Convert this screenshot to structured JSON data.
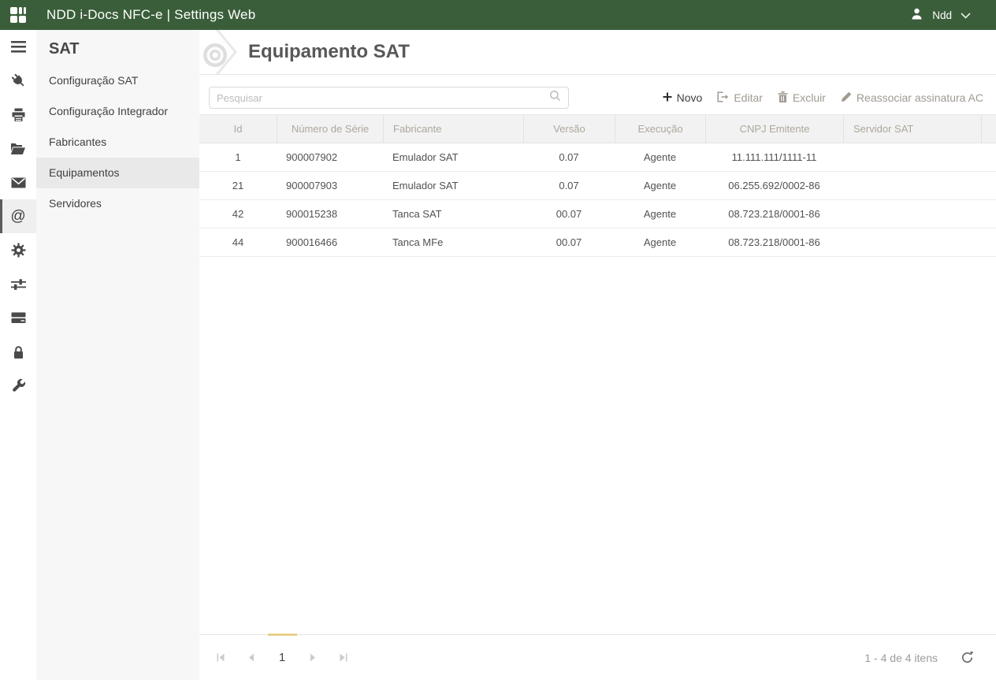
{
  "topbar": {
    "title": "NDD i-Docs NFC-e | Settings Web",
    "user": "Ndd"
  },
  "colors": {
    "topbar_bg": "#3b5e3a",
    "pager_accent": "#e7d18c",
    "rail_icon": "#4a4a4a",
    "toolbar_disabled": "#a09a91"
  },
  "rail": {
    "items": [
      "menu",
      "plug",
      "printer",
      "folder-open",
      "envelope",
      "at",
      "gear",
      "sliders",
      "server",
      "lock",
      "wrench"
    ],
    "selected": "at"
  },
  "sidebar": {
    "title": "SAT",
    "items": [
      {
        "label": "Configuração SAT",
        "selected": false
      },
      {
        "label": "Configuração Integrador",
        "selected": false
      },
      {
        "label": "Fabricantes",
        "selected": false
      },
      {
        "label": "Equipamentos",
        "selected": true
      },
      {
        "label": "Servidores",
        "selected": false
      }
    ]
  },
  "page": {
    "title": "Equipamento SAT"
  },
  "search": {
    "placeholder": "Pesquisar"
  },
  "toolbar": {
    "new": "Novo",
    "edit": "Editar",
    "delete": "Excluir",
    "reassign": "Reassociar assinatura AC"
  },
  "grid": {
    "columns": [
      "Id",
      "Número de Série",
      "Fabricante",
      "Versão",
      "Execução",
      "CNPJ Emitente",
      "Servidor SAT"
    ],
    "rows": [
      {
        "id": "1",
        "serial": "900007902",
        "manufacturer": "Emulador SAT",
        "version": "0.07",
        "execution": "Agente",
        "cnpj": "11.111.111/1111-11",
        "server": ""
      },
      {
        "id": "21",
        "serial": "900007903",
        "manufacturer": "Emulador SAT",
        "version": "0.07",
        "execution": "Agente",
        "cnpj": "06.255.692/0002-86",
        "server": ""
      },
      {
        "id": "42",
        "serial": "900015238",
        "manufacturer": "Tanca SAT",
        "version": "00.07",
        "execution": "Agente",
        "cnpj": "08.723.218/0001-86",
        "server": ""
      },
      {
        "id": "44",
        "serial": "900016466",
        "manufacturer": "Tanca MFe",
        "version": "00.07",
        "execution": "Agente",
        "cnpj": "08.723.218/0001-86",
        "server": ""
      }
    ]
  },
  "pager": {
    "page": "1",
    "info": "1 - 4 de 4 itens"
  }
}
